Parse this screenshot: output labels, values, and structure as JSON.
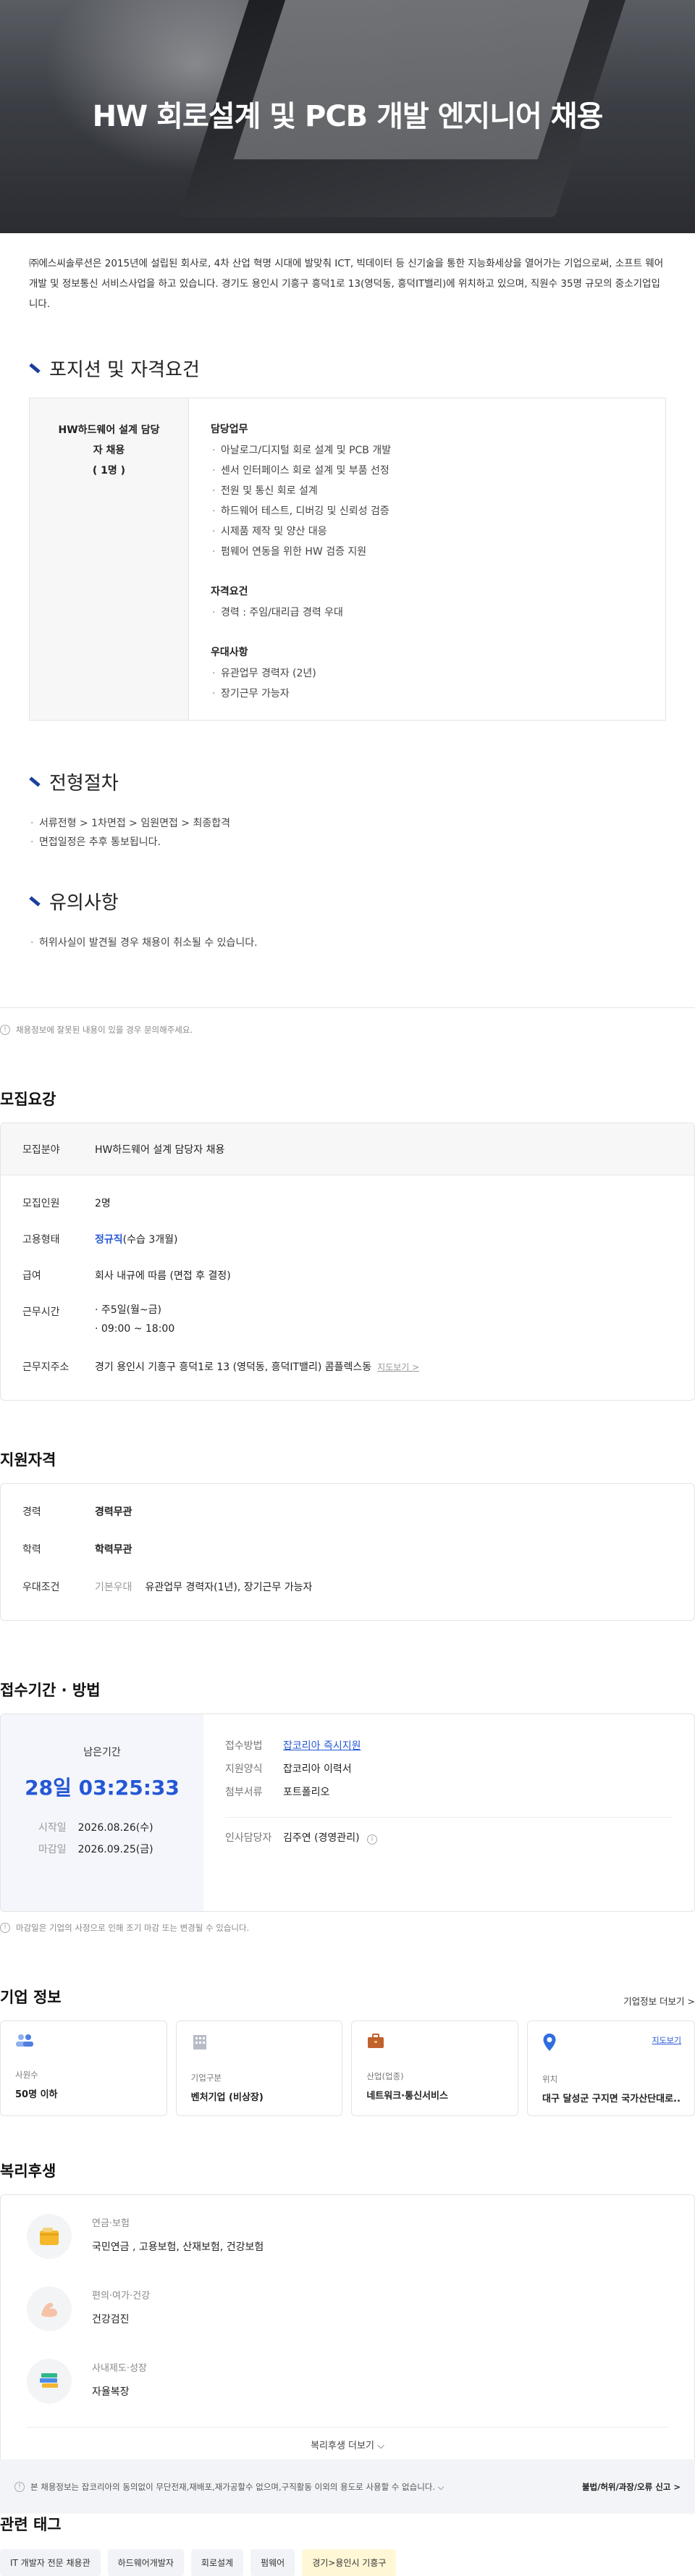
{
  "hero": {
    "title": "HW 회로설계 및 PCB 개발 엔지니어 채용"
  },
  "intro": "㈜에스씨솔루션은 2015년에 설립된 회사로, 4차 산업 혁명 시대에 발맞춰 ICT, 빅데이터 등 신기술을 통한 지능화세상을 열어가는 기업으로써, 소프트 웨어 개발 및 정보통신 서비스사업을 하고 있습니다. 경기도 용인시 기흥구 흥덕1로 13(영덕동, 흥덕IT밸리)에 위치하고 있으며, 직원수 35명 규모의 중소기업입니다.",
  "position": {
    "title": "포지션 및 자격요건",
    "role": "HW하드웨어 설계 담당자 채용",
    "headcount": "( 1명 )",
    "duties_title": "담당업무",
    "duties": [
      "아날로그/디지털 회로 설계 및 PCB 개발",
      "센서 인터페이스 회로 설계 및 부품 선정",
      "전원 및 통신 회로 설계",
      "하드웨어 테스트, 디버깅 및 신뢰성 검증",
      "시제품 제작 및 양산 대응",
      "펌웨어 연동을 위한 HW 검증 지원"
    ],
    "req_title": "자격요건",
    "reqs": [
      "경력 : 주임/대리급 경력 우대"
    ],
    "pref_title": "우대사항",
    "prefs": [
      "유관업무 경력자 (2년)",
      "장기근무 가능자"
    ]
  },
  "process": {
    "title": "전형절차",
    "items": [
      "서류전형 > 1차면접 > 임원면접 > 최종합격",
      "면접일정은 추후 통보됩니다."
    ]
  },
  "caution": {
    "title": "유의사항",
    "items": [
      "허위사실이 발견될 경우 채용이 취소될 수 있습니다."
    ]
  },
  "report_notice": "채용정보에 잘못된 내용이 있을 경우 문의해주세요.",
  "recruit": {
    "title": "모집요강",
    "field_k": "모집분야",
    "field_v": "HW하드웨어 설계 담당자 채용",
    "people_k": "모집인원",
    "people_v": "2명",
    "type_k": "고용형태",
    "type_v1": "정규직",
    "type_v2": "(수습 3개월)",
    "pay_k": "급여",
    "pay_v": "회사 내규에 따름 (면접 후 결정)",
    "time_k": "근무시간",
    "time_v1": "주5일(월~금)",
    "time_v2": "09:00 ~ 18:00",
    "addr_k": "근무지주소",
    "addr_v": "경기 용인시 기흥구 흥덕1로 13 (영덕동, 흥덕IT밸리) 콤플렉스동",
    "map_link": "지도보기 >"
  },
  "qual": {
    "title": "지원자격",
    "career_k": "경력",
    "career_v": "경력무관",
    "edu_k": "학력",
    "edu_v": "학력무관",
    "pref_k": "우대조건",
    "pref_sub": "기본우대",
    "pref_v": "유관업무 경력자(1년), 장기근무 가능자"
  },
  "apply": {
    "title": "접수기간 · 방법",
    "remain_label": "남은기간",
    "remain": "28일 03:25:33",
    "start_k": "시작일",
    "start_v": "2026.08.26(수)",
    "end_k": "마감일",
    "end_v": "2026.09.25(금)",
    "method_k": "접수방법",
    "method_v": "잡코리아 즉시지원",
    "form_k": "지원양식",
    "form_v": "잡코리아 이력서",
    "attach_k": "첨부서류",
    "attach_v": "포트폴리오",
    "hr_k": "인사담당자",
    "hr_v": "김주연 (경영관리)",
    "notice": "마감일은 기업의 사정으로 인해 조기 마감 또는 변경될 수 있습니다."
  },
  "company": {
    "title": "기업 정보",
    "more": "기업정보 더보기 >",
    "cards": [
      {
        "icon": "people-icon",
        "label": "사원수",
        "value": "50명 이하"
      },
      {
        "icon": "building-icon",
        "label": "기업구분",
        "value": "벤처기업 (비상장)"
      },
      {
        "icon": "briefcase-icon",
        "label": "산업(업종)",
        "value": "네트워크·통신서비스"
      },
      {
        "icon": "location-pin-icon",
        "label": "위치",
        "value": "대구 달성군 구지면 국가산단대로...",
        "link": "지도보기"
      }
    ]
  },
  "welfare": {
    "title": "복리후생",
    "items": [
      {
        "icon": "wallet-icon",
        "title": "연금·보험",
        "desc": "국민연금 , 고용보험, 산재보험, 건강보험"
      },
      {
        "icon": "muscle-icon",
        "title": "편의·여가·건강",
        "desc": "건강검진"
      },
      {
        "icon": "books-icon",
        "title": "사내제도·성장",
        "desc": "자율복장"
      }
    ],
    "more": "복리후생 더보기 ⌵"
  },
  "tags": {
    "title": "관련 태그",
    "items": [
      "IT 개발자 전문 채용관",
      "하드웨어개발자",
      "회로설계",
      "펌웨어",
      "경기>용인시 기흥구"
    ]
  },
  "footer": {
    "left": "본 채용정보는 잡코리아의 동의없이 무단전재,재배포,재가공할수 없으며,구직활동 이외의 용도로 사용할 수 없습니다. ⌵",
    "right": "불법/허위/과장/오류 신고 >"
  },
  "colors": {
    "accent": "#2457d6",
    "section_bar": "#1a3f9c"
  }
}
